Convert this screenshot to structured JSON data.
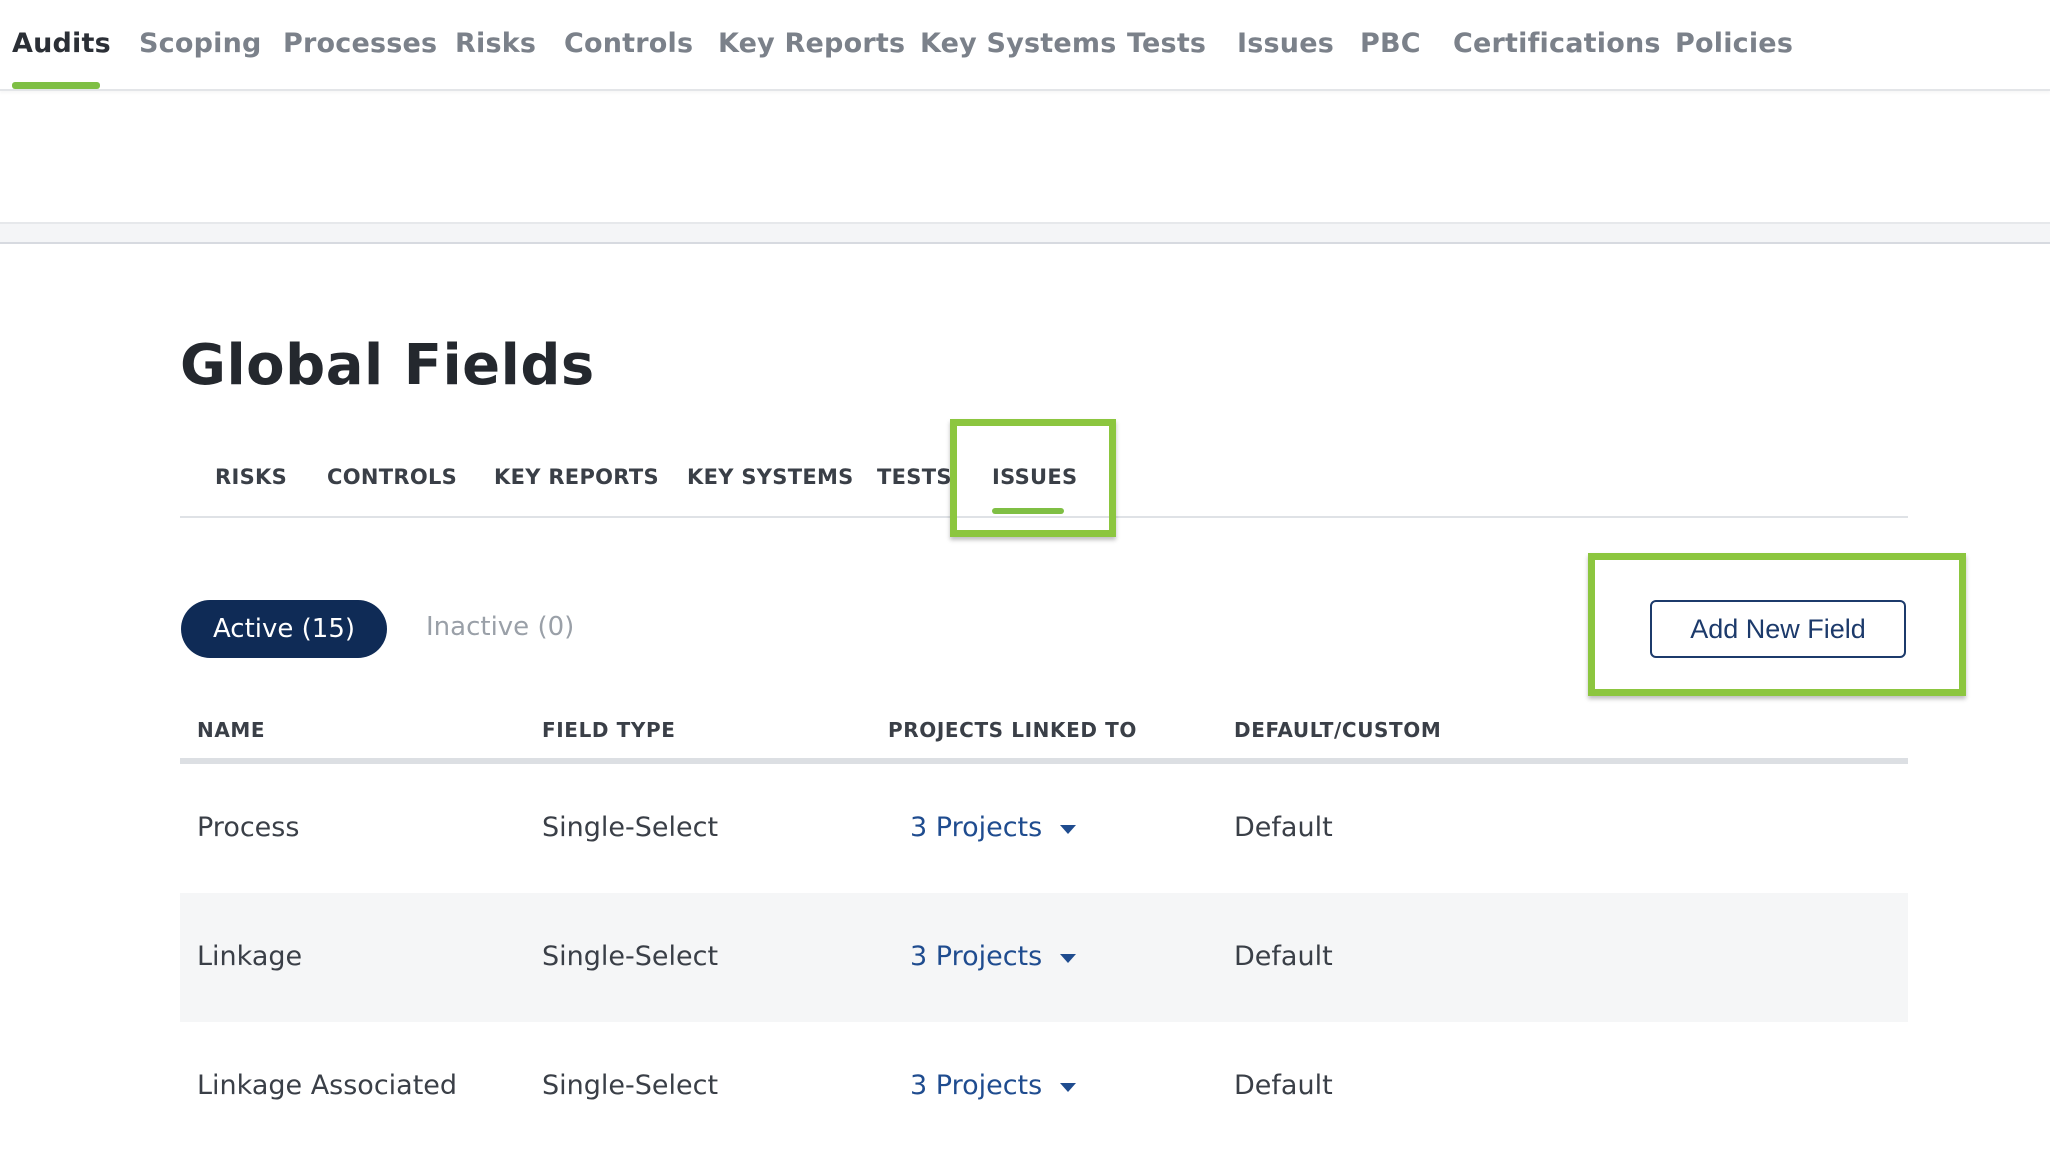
{
  "top_nav": {
    "items": [
      "Audits",
      "Scoping",
      "Processes",
      "Risks",
      "Controls",
      "Key Reports",
      "Key Systems",
      "Tests",
      "Issues",
      "PBC",
      "Certifications",
      "Policies"
    ],
    "active": "Audits"
  },
  "page": {
    "title": "Global Fields"
  },
  "sub_tabs": {
    "items": [
      "RISKS",
      "CONTROLS",
      "KEY REPORTS",
      "KEY SYSTEMS",
      "TESTS",
      "ISSUES"
    ],
    "active": "ISSUES"
  },
  "filters": {
    "active_label": "Active (15)",
    "inactive_label": "Inactive (0)"
  },
  "actions": {
    "add_new_field": "Add New Field"
  },
  "table": {
    "columns": [
      "NAME",
      "FIELD TYPE",
      "PROJECTS LINKED TO",
      "DEFAULT/CUSTOM"
    ],
    "rows": [
      {
        "name": "Process",
        "field_type": "Single-Select",
        "projects": "3 Projects",
        "kind": "Default"
      },
      {
        "name": "Linkage",
        "field_type": "Single-Select",
        "projects": "3 Projects",
        "kind": "Default"
      },
      {
        "name": "Linkage Associated",
        "field_type": "Single-Select",
        "projects": "3 Projects",
        "kind": "Default"
      }
    ]
  },
  "colors": {
    "accent_green": "#7fbf44",
    "highlight_green": "#8cc63f",
    "navy": "#0f2b56",
    "link_blue": "#1f4c8f"
  },
  "icons": {
    "dropdown": "chevron-down-icon"
  }
}
